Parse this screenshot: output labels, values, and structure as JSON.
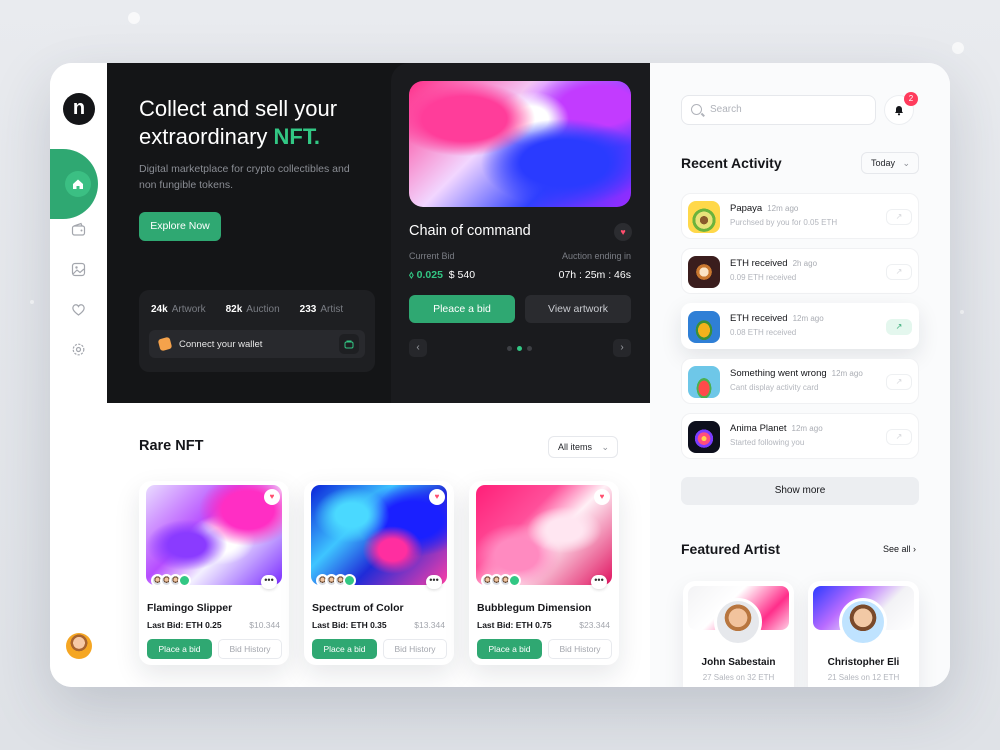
{
  "brand": {
    "logo_letter": "n"
  },
  "sidebar": {
    "items": [
      {
        "icon": "home-icon"
      },
      {
        "icon": "wallet-icon"
      },
      {
        "icon": "image-icon"
      },
      {
        "icon": "heart-icon"
      },
      {
        "icon": "gear-icon"
      }
    ]
  },
  "hero": {
    "title_line1": "Collect and sell your",
    "title_line2": "extraordinary",
    "title_highlight": "NFT.",
    "subtitle": "Digital marketplace for crypto collectibles and non fungible tokens.",
    "explore_label": "Explore Now",
    "stats": [
      {
        "value": "24k",
        "label": "Artwork"
      },
      {
        "value": "82k",
        "label": "Auction"
      },
      {
        "value": "233",
        "label": "Artist"
      }
    ],
    "wallet_label": "Connect your wallet"
  },
  "featured": {
    "title": "Chain of command",
    "current_bid_label": "Current Bid",
    "eth_value": "0.025",
    "usd_value": "$ 540",
    "auction_label": "Auction ending in",
    "timer": "07h : 25m : 46s",
    "bid_label": "Pleace a bid",
    "view_label": "View artwork"
  },
  "rare": {
    "title": "Rare NFT",
    "filter": "All items",
    "cards": [
      {
        "name": "Flamingo Slipper",
        "last_bid": "Last Bid: ETH 0.25",
        "usd": "$10.344",
        "bid": "Place a bid",
        "history": "Bid History"
      },
      {
        "name": "Spectrum of Color",
        "last_bid": "Last Bid: ETH 0.35",
        "usd": "$13.344",
        "bid": "Place a bid",
        "history": "Bid History"
      },
      {
        "name": "Bubblegum Dimension",
        "last_bid": "Last Bid: ETH 0.75",
        "usd": "$23.344",
        "bid": "Place a bid",
        "history": "Bid History"
      }
    ]
  },
  "search": {
    "placeholder": "Search"
  },
  "notifications": {
    "count": "2"
  },
  "activity": {
    "title": "Recent Activity",
    "filter": "Today",
    "items": [
      {
        "title": "Papaya",
        "time": "12m ago",
        "sub": "Purchsed by you for 0.05 ETH"
      },
      {
        "title": "ETH received",
        "time": "2h ago",
        "sub": "0.09 ETH received"
      },
      {
        "title": "ETH received",
        "time": "12m ago",
        "sub": "0.08 ETH received"
      },
      {
        "title": "Something went wrong",
        "time": "12m ago",
        "sub": "Cant display activity card"
      },
      {
        "title": "Anima Planet",
        "time": "12m ago",
        "sub": "Started following you"
      }
    ],
    "show_more": "Show more"
  },
  "artists": {
    "title": "Featured Artist",
    "see_all": "See all",
    "items": [
      {
        "name": "John Sabestain",
        "sub": "27 Sales on 32 ETH"
      },
      {
        "name": "Christopher Eli",
        "sub": "21 Sales on 12 ETH"
      }
    ]
  },
  "colors": {
    "accent": "#2fa872",
    "accent_text": "#32c784",
    "dark": "#141517",
    "alert": "#ff3b5c"
  }
}
